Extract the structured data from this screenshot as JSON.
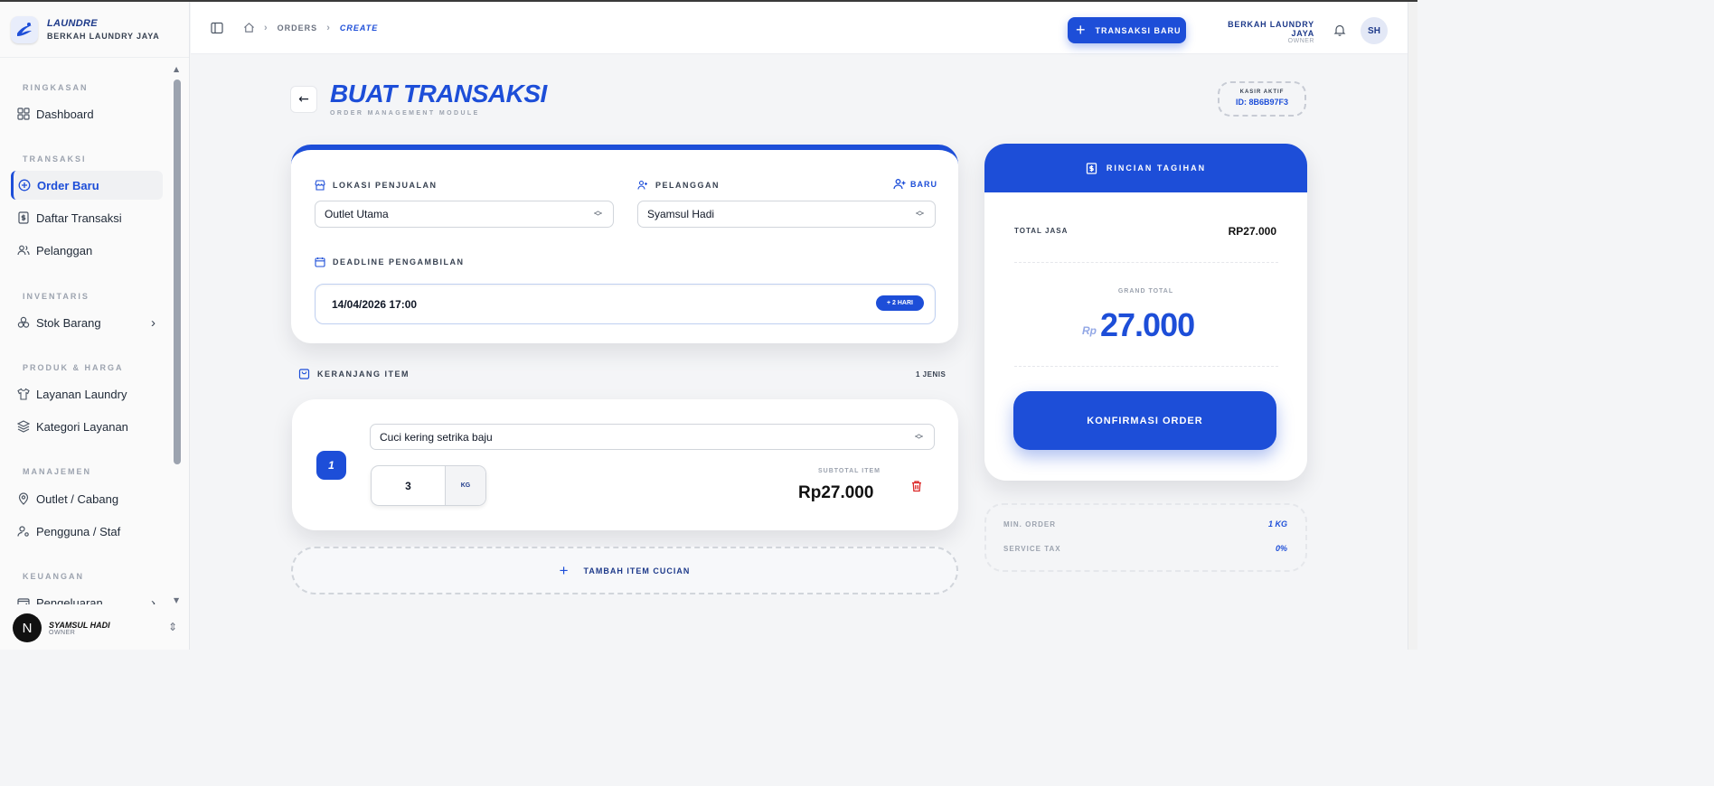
{
  "brand": {
    "name": "LAUNDRE",
    "sub": "BERKAH LAUNDRY JAYA"
  },
  "sidebar": {
    "sections": [
      {
        "title": "RINGKASAN"
      },
      {
        "title": "TRANSAKSI"
      },
      {
        "title": "INVENTARIS"
      },
      {
        "title": "PRODUK & HARGA"
      },
      {
        "title": "MANAJEMEN"
      },
      {
        "title": "KEUANGAN"
      }
    ],
    "items": [
      {
        "label": "Dashboard",
        "icon": "grid-icon"
      },
      {
        "label": "Order Baru",
        "icon": "plus-circle-icon",
        "active": true
      },
      {
        "label": "Daftar Transaksi",
        "icon": "receipt-icon"
      },
      {
        "label": "Pelanggan",
        "icon": "users-icon"
      },
      {
        "label": "Stok Barang",
        "icon": "boxes-icon"
      },
      {
        "label": "Layanan Laundry",
        "icon": "shirt-icon"
      },
      {
        "label": "Kategori Layanan",
        "icon": "layers-icon"
      },
      {
        "label": "Outlet / Cabang",
        "icon": "map-pin-icon"
      },
      {
        "label": "Pengguna / Staf",
        "icon": "user-cog-icon"
      },
      {
        "label": "Pengeluaran",
        "icon": "wallet-icon"
      }
    ],
    "user": {
      "initial": "N",
      "name": "SYAMSUL HADI",
      "role": "OWNER"
    }
  },
  "topbar": {
    "crumbs": [
      "ORDERS",
      "CREATE"
    ],
    "new_button": "TRANSAKSI BARU",
    "org": "BERKAH LAUNDRY JAYA",
    "role": "OWNER",
    "avatar": "SH"
  },
  "page": {
    "title": "BUAT TRANSAKSI",
    "subtitle": "ORDER MANAGEMENT MODULE",
    "kasir_label": "KASIR AKTIF",
    "kasir_id": "ID: 8B6B97F3"
  },
  "form": {
    "location_label": "LOKASI PENJUALAN",
    "location_value": "Outlet Utama",
    "customer_label": "PELANGGAN",
    "customer_value": "Syamsul Hadi",
    "new_customer": "BARU",
    "deadline_label": "DEADLINE PENGAMBILAN",
    "deadline_value": "14/04/2026 17:00",
    "deadline_badge": "+ 2 HARI"
  },
  "cart": {
    "title": "KERANJANG ITEM",
    "count": "1 JENIS",
    "items": [
      {
        "index": "1",
        "service": "Cuci kering setrika baju",
        "qty": "3",
        "unit": "KG",
        "subtotal_label": "SUBTOTAL ITEM",
        "subtotal": "Rp27.000"
      }
    ],
    "add_label": "TAMBAH ITEM CUCIAN"
  },
  "bill": {
    "title": "RINCIAN TAGIHAN",
    "total_jasa_label": "TOTAL JASA",
    "total_jasa_value": "RP27.000",
    "grand_total_label": "GRAND TOTAL",
    "currency": "Rp",
    "grand_total_value": "27.000",
    "confirm": "KONFIRMASI ORDER",
    "min_order_label": "MIN. ORDER",
    "min_order_value": "1 KG",
    "tax_label": "SERVICE TAX",
    "tax_value": "0%"
  },
  "colors": {
    "accent": "#1d4ed8",
    "danger": "#dc2626"
  }
}
